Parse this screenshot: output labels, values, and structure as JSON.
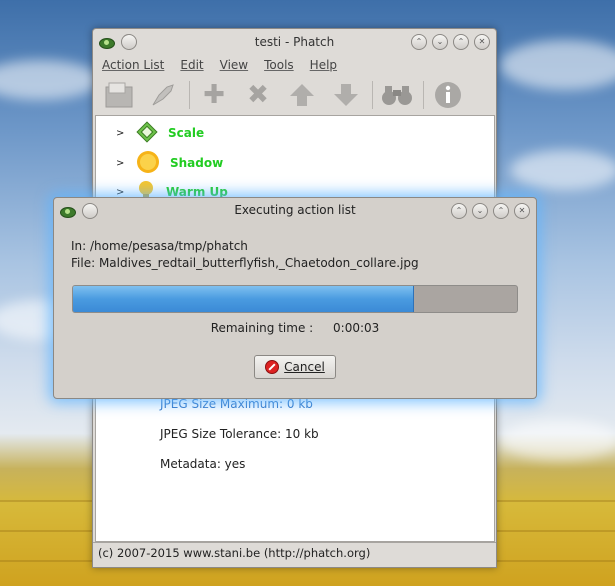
{
  "window": {
    "title": "testi - Phatch",
    "menu": [
      "Action List",
      "Edit",
      "View",
      "Tools",
      "Help"
    ],
    "actions": [
      {
        "label": "Scale",
        "icon": "scale-icon"
      },
      {
        "label": "Shadow",
        "icon": "sun-icon"
      },
      {
        "label": "Warm Up",
        "icon": "lightbulb-icon"
      }
    ],
    "params": {
      "jpeg_max": "JPEG Size Maximum: 0  kb",
      "jpeg_tol": "JPEG Size Tolerance: 10  kb",
      "metadata": "Metadata: yes"
    },
    "status": "(c) 2007-2015 www.stani.be (http://phatch.org)"
  },
  "dialog": {
    "title": "Executing action list",
    "in_path": "In: /home/pesasa/tmp/phatch",
    "file": "File: Maldives_redtail_butterflyfish,_Chaetodon_collare.jpg",
    "progress": 0.765,
    "remaining_label": "Remaining time :",
    "remaining_value": "0:00:03",
    "cancel_label": "Cancel"
  }
}
